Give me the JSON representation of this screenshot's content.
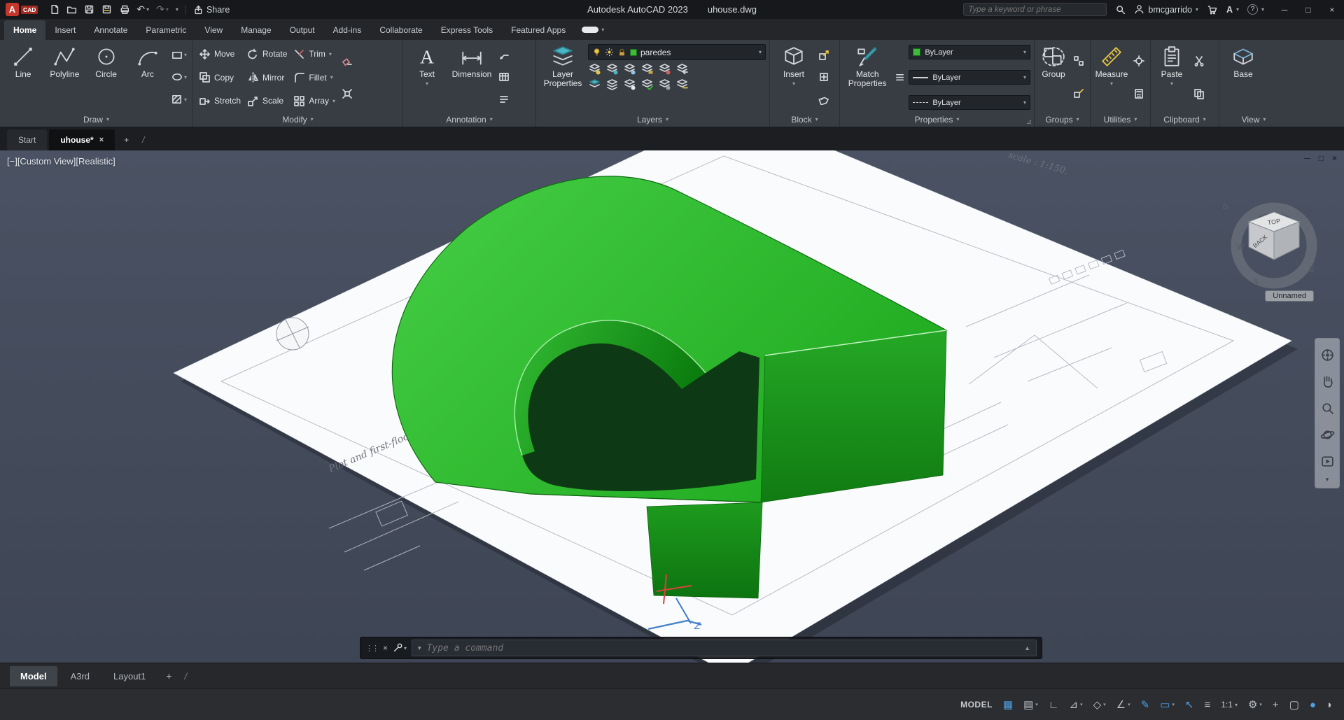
{
  "titlebar": {
    "logo_a": "A",
    "logo_cad": "CAD",
    "share_label": "Share",
    "app_title": "Autodesk AutoCAD 2023",
    "doc_title": "uhouse.dwg",
    "search_placeholder": "Type a keyword or phrase",
    "user_name": "bmcgarrido",
    "help_label": "?"
  },
  "icons": {
    "chevron": "▾",
    "chevron_right": "▸",
    "dots": "⋮⋮",
    "undo": "↶",
    "redo": "↷",
    "minimize": "─",
    "maximize": "□",
    "close": "×",
    "home": "⌂",
    "history": "▲",
    "plus": "+",
    "slash": "/",
    "launcher": "◿",
    "text_glyph": "A"
  },
  "ribbon": {
    "tabs": [
      "Home",
      "Insert",
      "Annotate",
      "Parametric",
      "View",
      "Manage",
      "Output",
      "Add-ins",
      "Collaborate",
      "Express Tools",
      "Featured Apps"
    ]
  },
  "panels": {
    "draw": {
      "label": "Draw",
      "line": "Line",
      "polyline": "Polyline",
      "circle": "Circle",
      "arc": "Arc"
    },
    "modify": {
      "label": "Modify",
      "move": "Move",
      "copy": "Copy",
      "stretch": "Stretch",
      "rotate": "Rotate",
      "mirror": "Mirror",
      "scale": "Scale",
      "trim": "Trim",
      "fillet": "Fillet",
      "array": "Array"
    },
    "annotation": {
      "label": "Annotation",
      "text": "Text",
      "dimension": "Dimension"
    },
    "layers": {
      "label": "Layers",
      "layer_properties": "Layer Properties",
      "current_layer": "paredes"
    },
    "block": {
      "label": "Block",
      "insert": "Insert"
    },
    "properties": {
      "label": "Properties",
      "match": "Match Properties",
      "color_value": "ByLayer",
      "linetype_value": "ByLayer",
      "lineweight_value": "ByLayer"
    },
    "groups": {
      "label": "Groups",
      "group": "Group"
    },
    "utilities": {
      "label": "Utilities",
      "measure": "Measure"
    },
    "clipboard": {
      "label": "Clipboard",
      "paste": "Paste"
    },
    "view": {
      "label": "View",
      "base": "Base"
    }
  },
  "file_tabs": {
    "start": "Start",
    "doc": "uhouse*"
  },
  "viewport": {
    "controls": "[−][Custom View][Realistic]",
    "named_view": "Unnamed",
    "ucs_z": "Z",
    "captions": {
      "plan": "Plot and first-floor plan ; scale :  1:150.",
      "top": "scale :  1:150."
    },
    "viewcube": {
      "top": "TOP",
      "back": "BACK",
      "w": "W",
      "s": "S",
      "e": "E"
    }
  },
  "command_line": {
    "placeholder": "Type a command"
  },
  "layout_tabs": {
    "model": "Model",
    "a3rd": "A3rd",
    "layout1": "Layout1"
  },
  "statusbar": {
    "model_label": "MODEL",
    "scale": "1:1",
    "icons_a": [
      "▦",
      "▤",
      "∟",
      "⊿",
      "◇",
      "∠",
      "✎",
      "▭",
      "↖",
      "≡"
    ],
    "icons_b": [
      "⚙",
      "+",
      "▢",
      "●",
      "◗"
    ]
  },
  "colors": {
    "model_green": "#2fbb2f",
    "layer_green": "#3dbb3d",
    "accent_blue": "#4f9fe3"
  }
}
